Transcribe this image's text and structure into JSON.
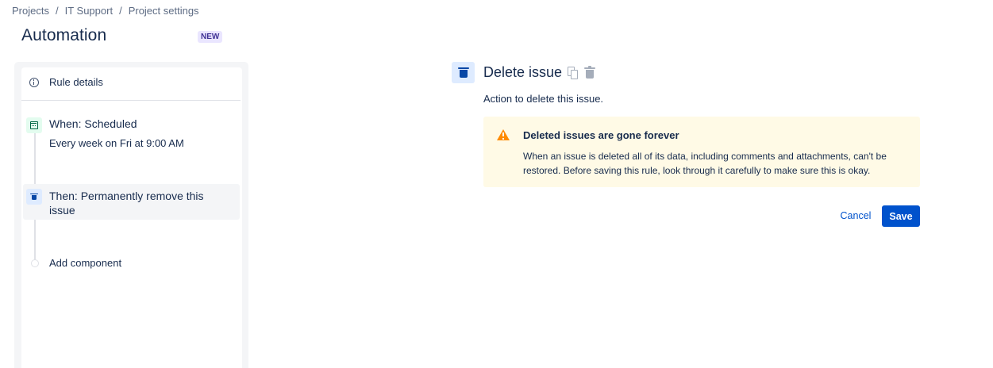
{
  "breadcrumb": {
    "items": [
      "Projects",
      "IT Support",
      "Project settings"
    ],
    "separator": "/"
  },
  "page": {
    "title": "Automation",
    "badge": "NEW"
  },
  "sidebar": {
    "rule_details_label": "Rule details",
    "trigger": {
      "icon": "calendar-icon",
      "title": "When: Scheduled",
      "subtitle": "Every week on Fri at 9:00 AM"
    },
    "action": {
      "icon": "trash-icon",
      "title": "Then: Permanently remove this issue",
      "selected": true
    },
    "add_component_label": "Add component"
  },
  "detail": {
    "title": "Delete issue",
    "description": "Action to delete this issue.",
    "warning": {
      "title": "Deleted issues are gone forever",
      "body": "When an issue is deleted all of its data, including comments and attachments, can't be restored. Before saving this rule, look through it carefully to make sure this is okay."
    },
    "buttons": {
      "cancel": "Cancel",
      "save": "Save"
    }
  },
  "colors": {
    "primary": "#0052cc",
    "warning_bg": "#fffae6",
    "warning_icon": "#ff8b00",
    "trigger_bg": "#e3fcef",
    "action_bg": "#deebff",
    "badge_bg": "#eae6ff"
  }
}
